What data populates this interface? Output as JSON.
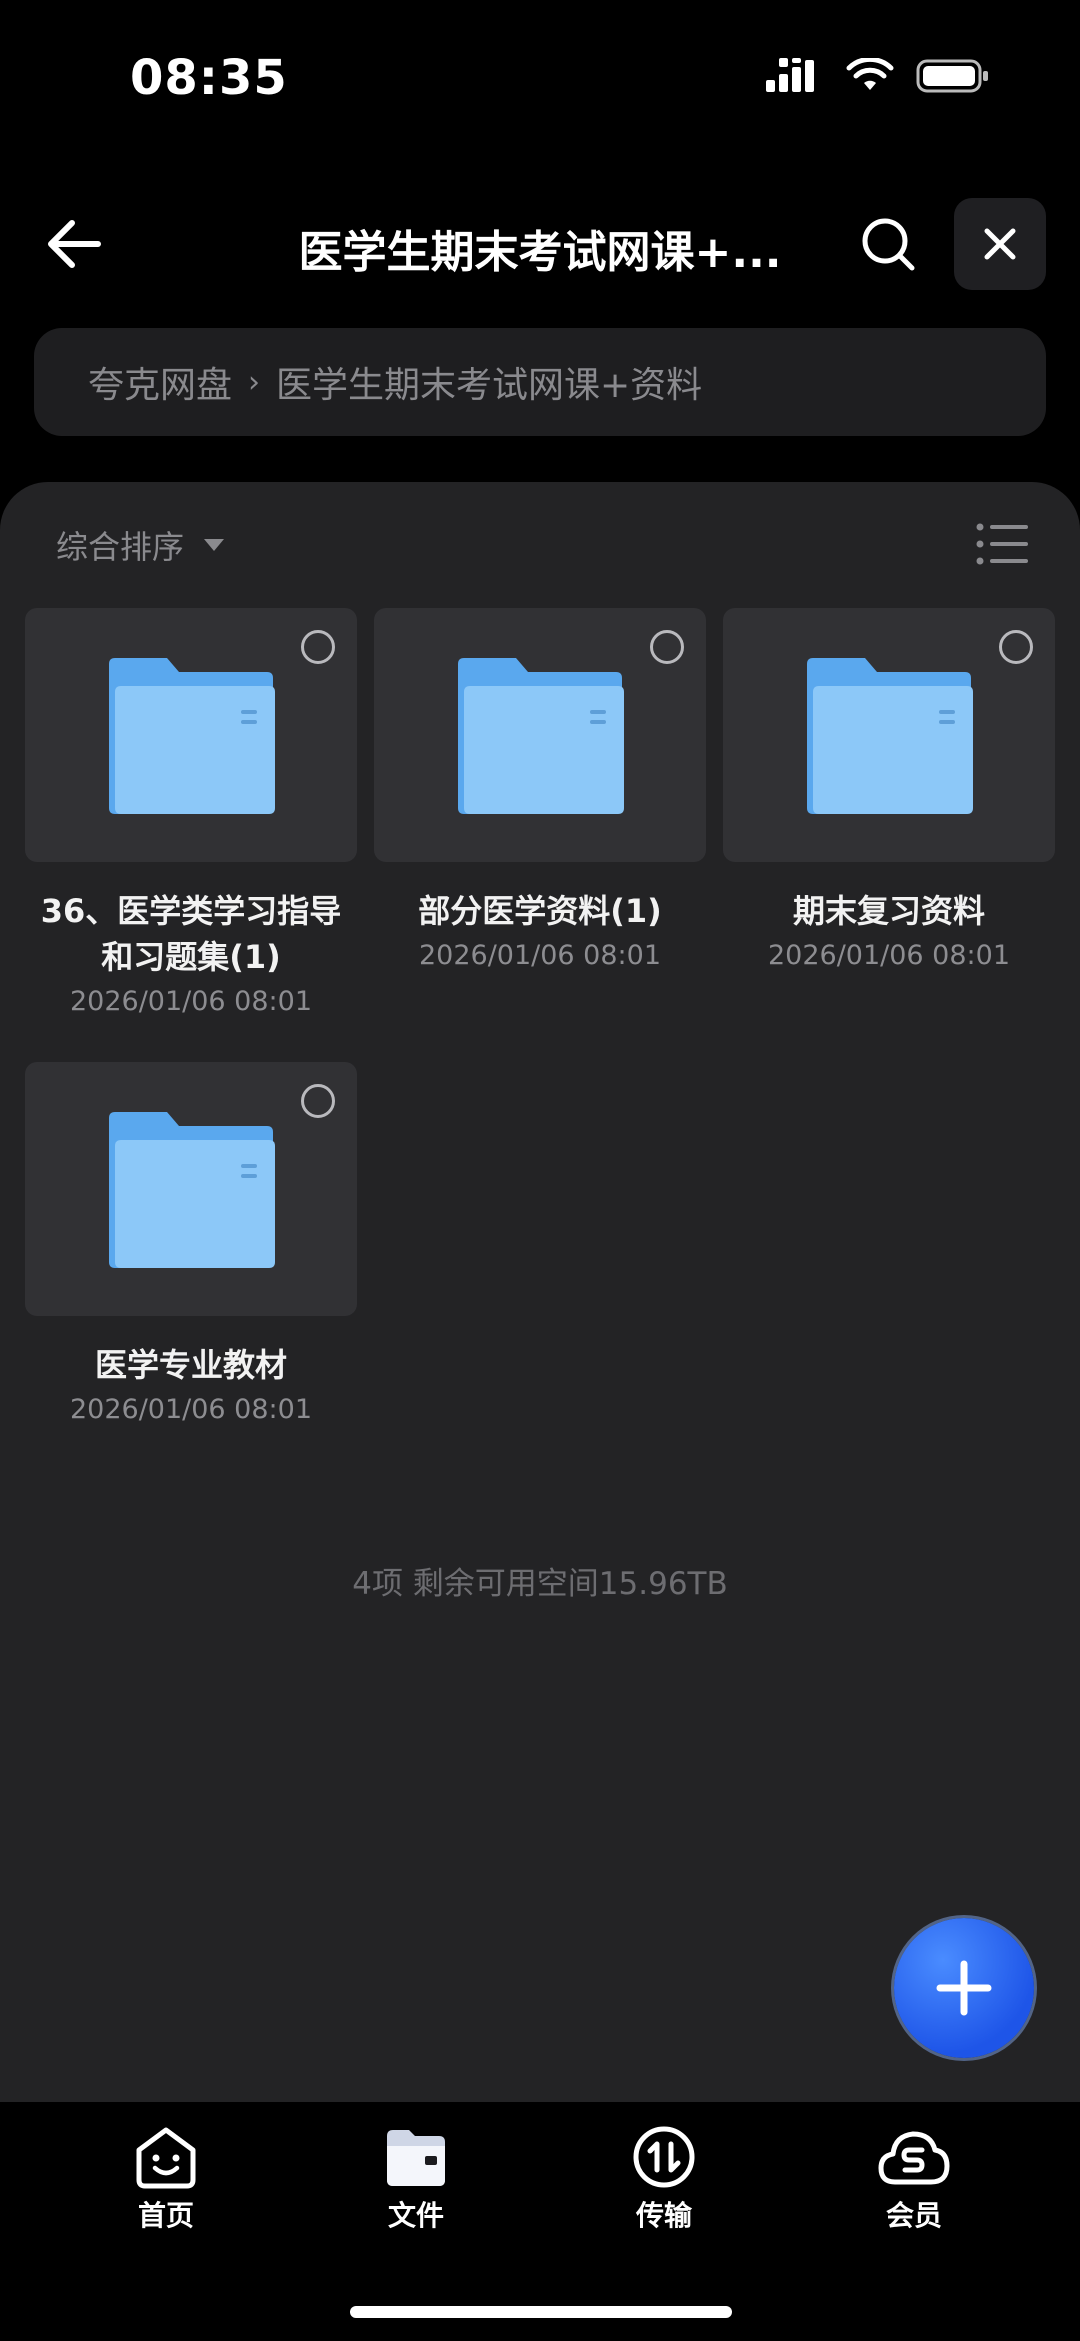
{
  "status_bar": {
    "time": "08:35"
  },
  "header": {
    "title": "医学生期末考试网课+...",
    "back_icon": "arrow-left-icon",
    "search_icon": "search-icon",
    "close_icon": "close-icon"
  },
  "breadcrumb": {
    "root": "夸克网盘",
    "separator": "›",
    "current": "医学生期末考试网课+资料"
  },
  "sort": {
    "label": "综合排序"
  },
  "folders": [
    {
      "name": "36、医学类学习指导和习题集(1)",
      "date": "2026/01/06 08:01"
    },
    {
      "name": "部分医学资料(1)",
      "date": "2026/01/06 08:01"
    },
    {
      "name": "期末复习资料",
      "date": "2026/01/06 08:01"
    },
    {
      "name": "医学专业教材",
      "date": "2026/01/06 08:01"
    }
  ],
  "summary": "4项 剩余可用空间15.96TB",
  "bottom_nav": {
    "items": [
      {
        "label": "首页",
        "icon": "smile-face-icon"
      },
      {
        "label": "文件",
        "icon": "folder-icon",
        "active": true
      },
      {
        "label": "传输",
        "icon": "transfer-icon"
      },
      {
        "label": "会员",
        "icon": "vip-cloud-icon"
      }
    ]
  },
  "colors": {
    "accent": "#2563eb",
    "folder": "#6cb4f0",
    "panel": "#232325"
  }
}
